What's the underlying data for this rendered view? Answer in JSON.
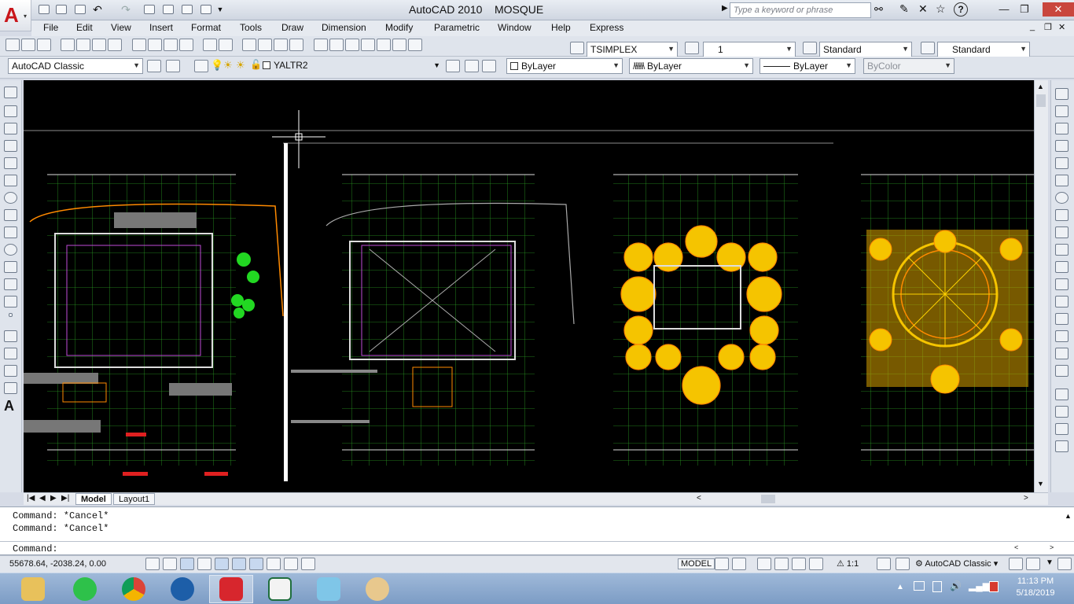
{
  "app": {
    "title": "AutoCAD 2010",
    "document": "MOSQUE",
    "logo_letter": "A",
    "search_placeholder": "Type a keyword or phrase"
  },
  "menus": [
    "File",
    "Edit",
    "View",
    "Insert",
    "Format",
    "Tools",
    "Draw",
    "Dimension",
    "Modify",
    "Parametric",
    "Window",
    "Help",
    "Express"
  ],
  "styles": {
    "text_style": "TSIMPLEX",
    "dim_scale": "1",
    "dim_style": "Standard",
    "table_style": "Standard"
  },
  "workspace": {
    "name": "AutoCAD Classic",
    "layer": "YALTR2",
    "color": "ByLayer",
    "linetype": "ByLayer",
    "lineweight": "ByLayer",
    "plotstyle": "ByColor"
  },
  "tabs": [
    "Model",
    "Layout1"
  ],
  "command": {
    "history": [
      "Command: *Cancel*",
      "Command: *Cancel*"
    ],
    "prompt": "Command:"
  },
  "status": {
    "coords": "55678.64, -2038.24, 0.00",
    "space": "MODEL",
    "scale": "1:1",
    "workspace": "AutoCAD Classic"
  },
  "taskbar": {
    "apps": [
      "file-explorer",
      "line",
      "chrome",
      "media",
      "autocad",
      "document",
      "notepad",
      "paint"
    ],
    "time": "11:13 PM",
    "date": "5/18/2019"
  },
  "colors": {
    "canvas": "#000000",
    "grid_green": "#39d22e",
    "accent_red": "#e02020",
    "accent_orange": "#ff8a00",
    "yellow": "#ffd200",
    "magenta": "#c04bd8"
  }
}
